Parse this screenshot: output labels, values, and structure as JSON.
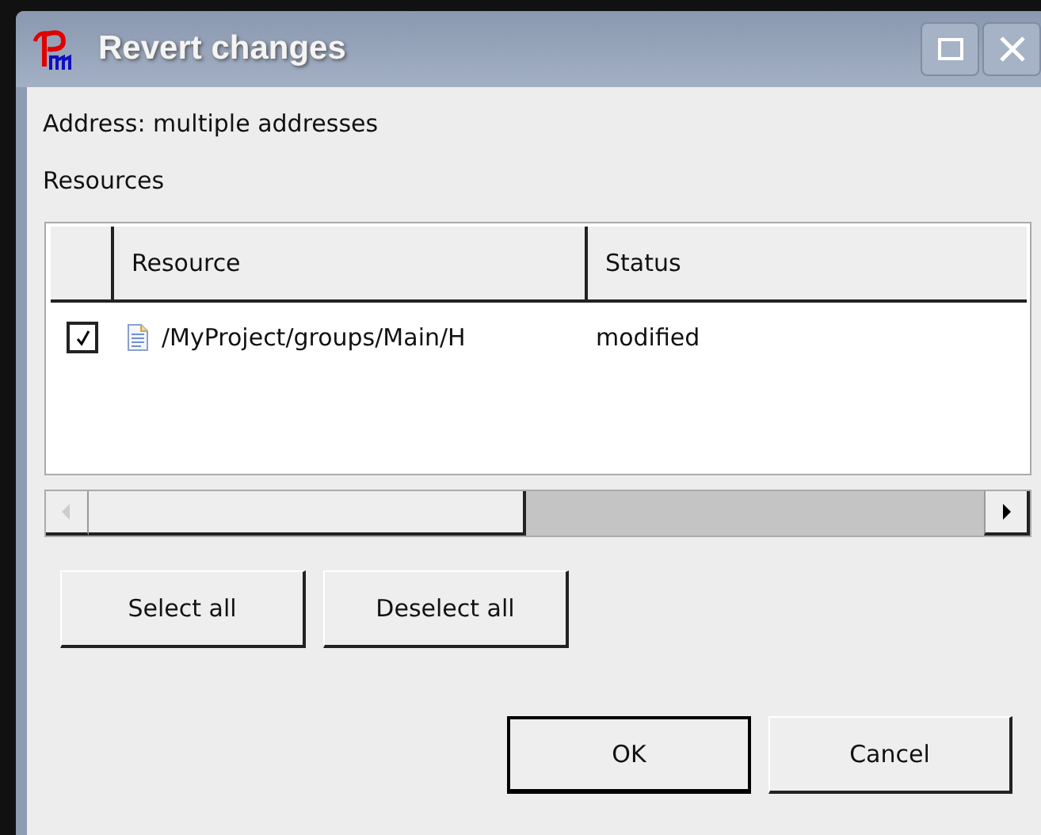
{
  "window": {
    "title": "Revert changes"
  },
  "address": "Address: multiple addresses",
  "resources_label": "Resources",
  "table": {
    "columns": [
      "Resource",
      "Status"
    ],
    "rows": [
      {
        "checked": true,
        "resource": "/MyProject/groups/Main/H",
        "status": "modified"
      }
    ]
  },
  "selection_buttons": [
    "Select all",
    "Deselect all"
  ],
  "dialog_buttons": [
    {
      "label": "OK",
      "default": true
    },
    {
      "label": "Cancel",
      "default": false
    }
  ]
}
